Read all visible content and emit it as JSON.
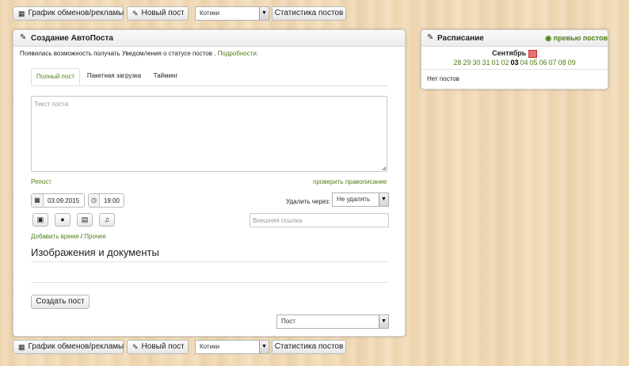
{
  "toolbar_top": {
    "schedule_label": "График обменов/рекламы",
    "new_post_label": "Новый пост",
    "group_select": "Котики",
    "stats_label": "Статистика постов"
  },
  "toolbar_bottom": {
    "schedule_label": "График обменов/рекламы",
    "new_post_label": "Новый пост",
    "group_select": "Котики",
    "stats_label": "Статистика постов"
  },
  "create": {
    "title": "Создание АвтоПоста",
    "notice": "Появилась возможность получать Уведомления о статусе постов .",
    "notice_link": "Подробности.",
    "tabs": [
      "Полный пост",
      "Пакетная загрузка",
      "Тайминг"
    ],
    "textarea_placeholder": "Текст поста",
    "repost_link": "Репост",
    "spellcheck_link": "проверить правописание",
    "date": "03.09.2015",
    "time": "19:00",
    "delete_label": "Удалить через:",
    "delete_select": "Не удалять",
    "external_link_placeholder": "Внешняя ссылка",
    "add_time_link": "Добавить время",
    "separator": "/",
    "other_link": "Прочее",
    "images_heading": "Изображения и документы",
    "create_button": "Создать пост",
    "type_select": "Пост"
  },
  "schedule": {
    "title": "Расписание",
    "preview_link": "превью постов",
    "month": "Сентябрь",
    "days": [
      "28",
      "29",
      "30",
      "31",
      "01",
      "02",
      "03",
      "04",
      "05",
      "06",
      "07",
      "08",
      "09"
    ],
    "current_day": "03",
    "no_posts": "Нет постов"
  },
  "colors": {
    "link_green": "#4f7f16",
    "background": "#f0d9b4",
    "calendar_icon": "#d9534f"
  },
  "icons": {
    "schedule": "table-icon",
    "new_post": "pencil-icon",
    "preview": "eye-icon",
    "date": "calendar-icon",
    "time": "clock-icon",
    "media": [
      "image-icon",
      "globe-icon",
      "film-icon",
      "music-icon"
    ]
  }
}
